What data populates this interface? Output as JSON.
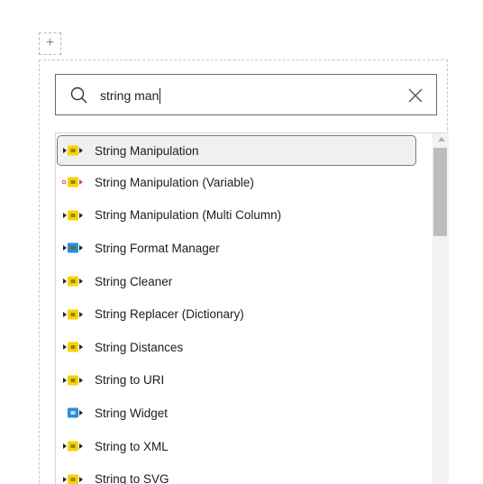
{
  "add_button": {
    "label": "+"
  },
  "search": {
    "value": "string man",
    "icon": "search-icon",
    "clear_icon": "close-icon"
  },
  "results": [
    {
      "label": "String Manipulation",
      "selected": true,
      "color": "#f5d20a",
      "icon": "node-manipulator-icon"
    },
    {
      "label": "String Manipulation (Variable)",
      "selected": false,
      "color": "#f5d20a",
      "icon": "node-variable-icon"
    },
    {
      "label": "String Manipulation (Multi Column)",
      "selected": false,
      "color": "#f5d20a",
      "icon": "node-manipulator-icon"
    },
    {
      "label": "String Format Manager",
      "selected": false,
      "color": "#2a8fd8",
      "icon": "node-view-icon"
    },
    {
      "label": "String Cleaner",
      "selected": false,
      "color": "#f5d20a",
      "icon": "node-manipulator-icon"
    },
    {
      "label": "String Replacer (Dictionary)",
      "selected": false,
      "color": "#f5d20a",
      "icon": "node-manipulator-icon"
    },
    {
      "label": "String Distances",
      "selected": false,
      "color": "#f5d20a",
      "icon": "node-manipulator-icon"
    },
    {
      "label": "String to URI",
      "selected": false,
      "color": "#f5d20a",
      "icon": "node-manipulator-icon"
    },
    {
      "label": "String Widget",
      "selected": false,
      "color": "#2a8fd8",
      "icon": "node-widget-icon"
    },
    {
      "label": "String to XML",
      "selected": false,
      "color": "#f5d20a",
      "icon": "node-manipulator-icon"
    },
    {
      "label": "String to SVG",
      "selected": false,
      "color": "#f5d20a",
      "icon": "node-manipulator-icon"
    }
  ]
}
